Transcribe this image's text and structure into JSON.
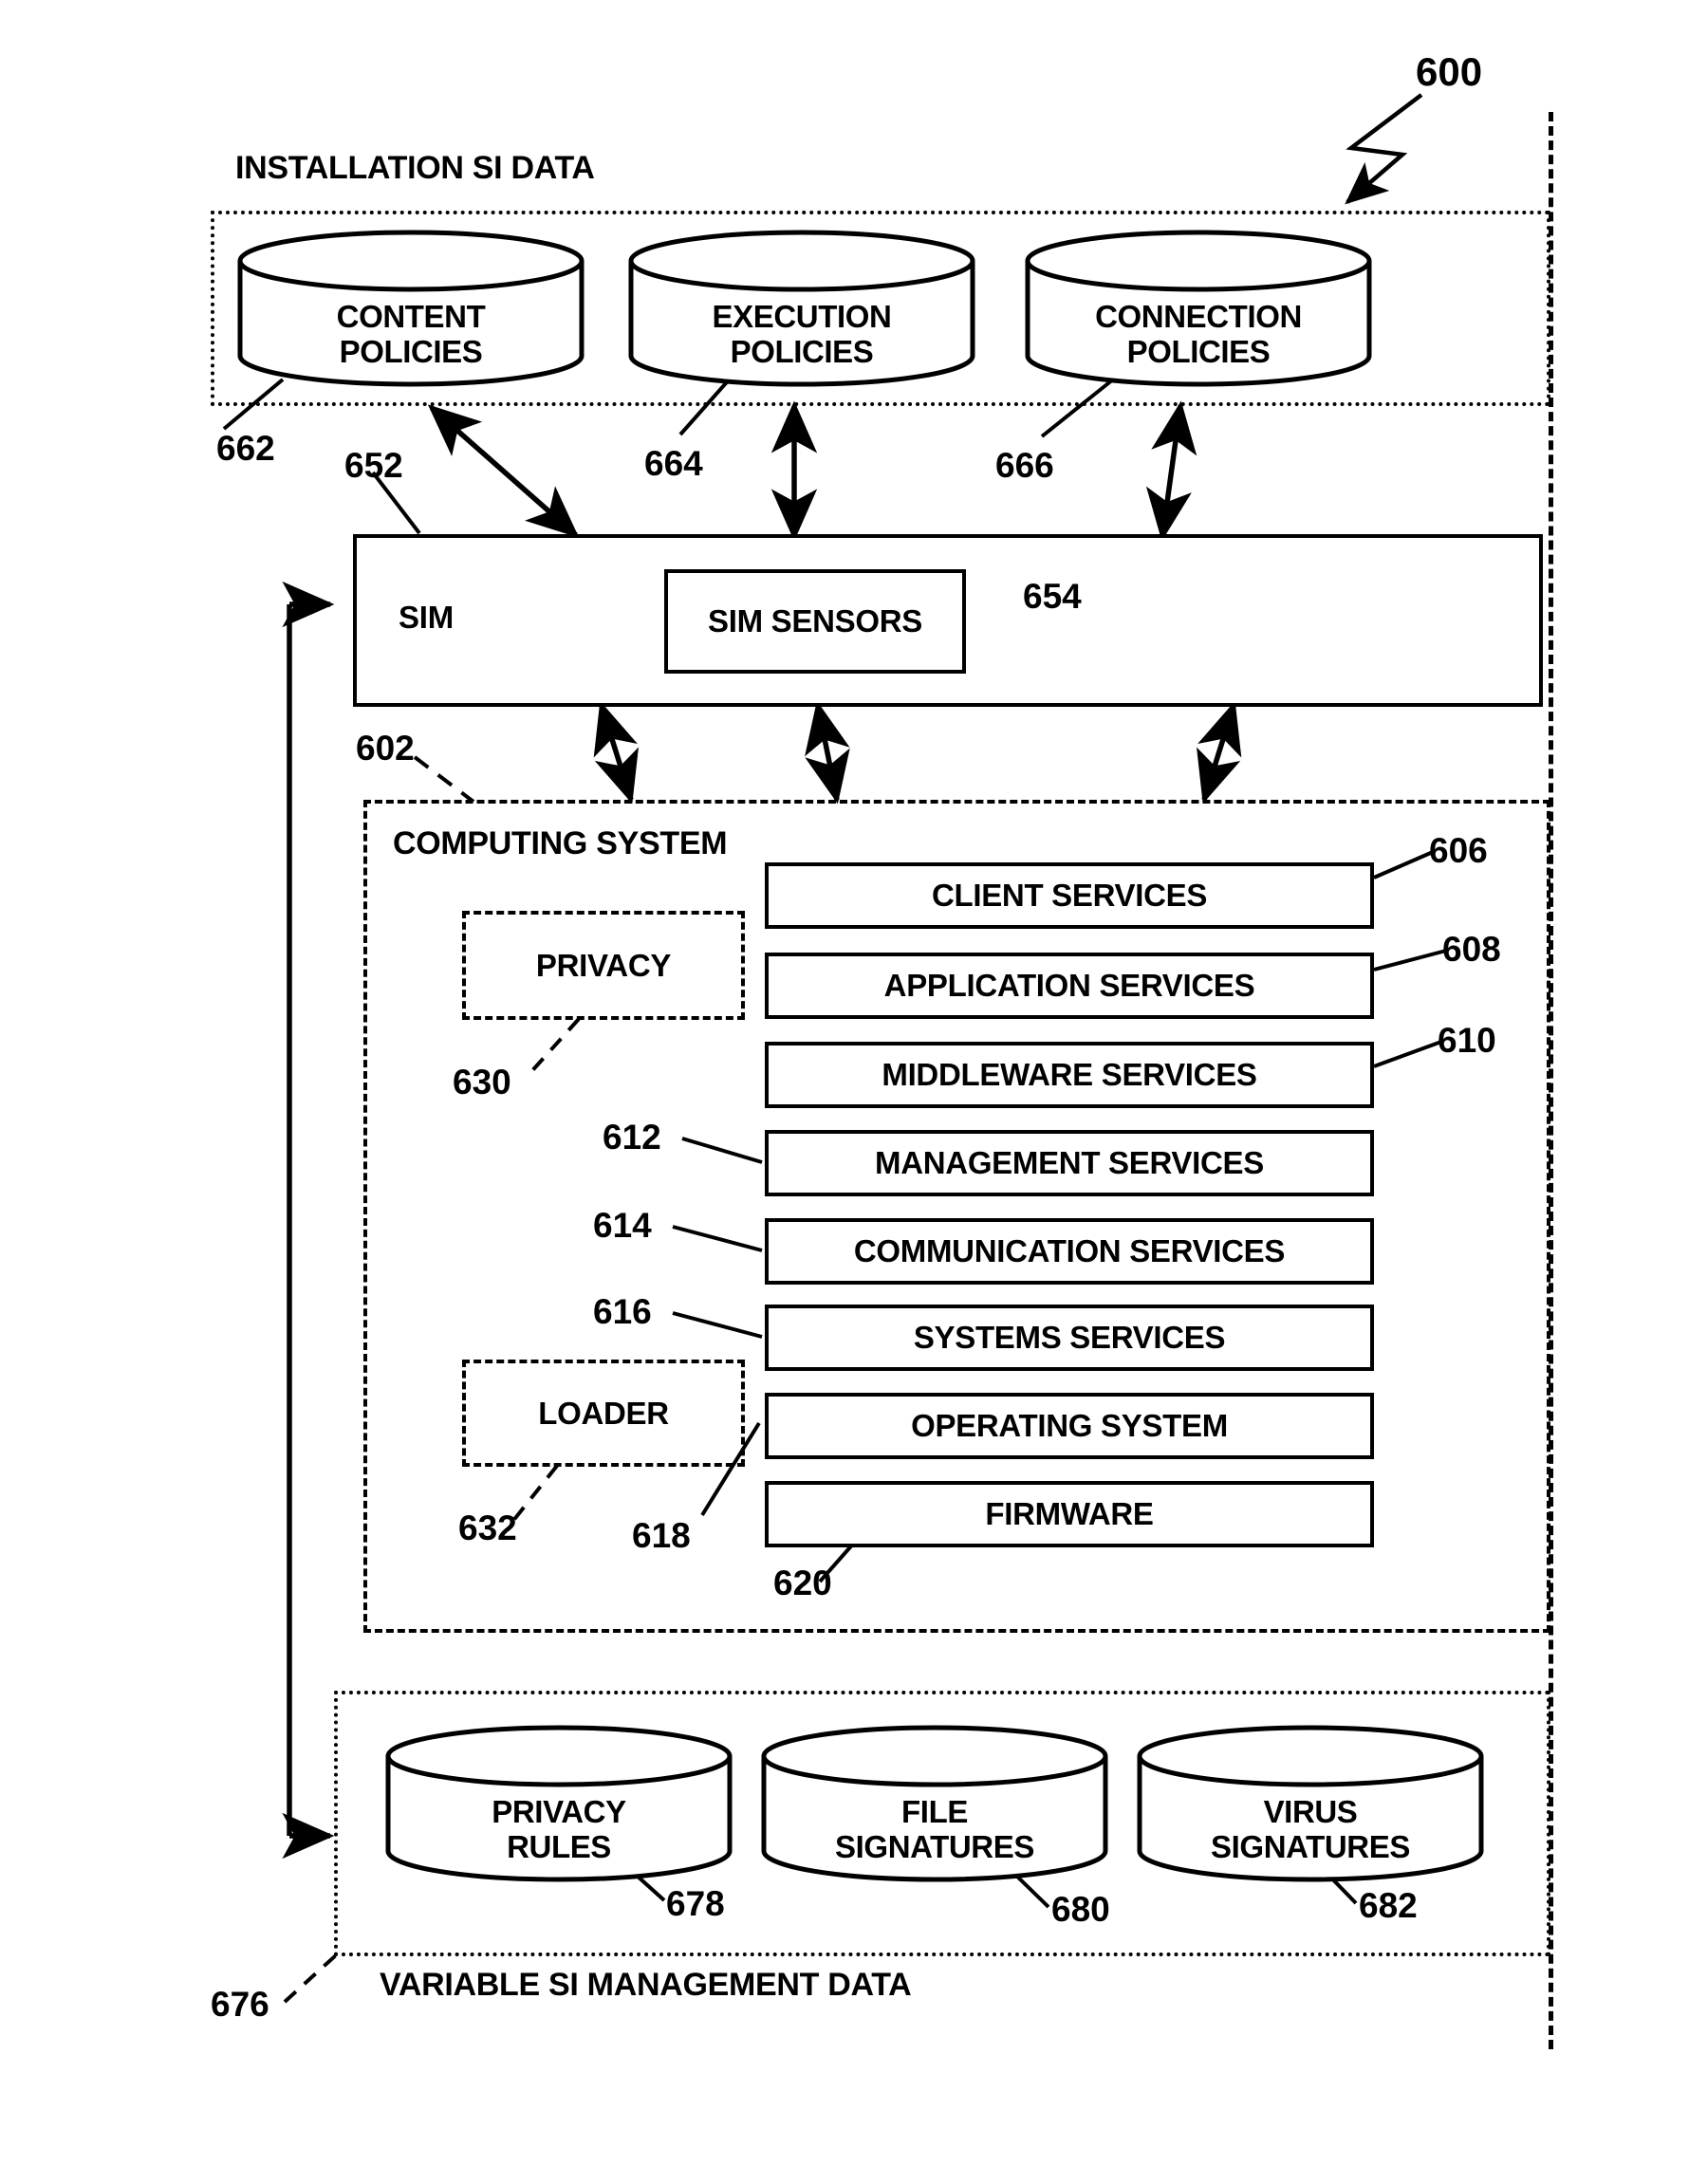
{
  "figure": {
    "number": "600",
    "right_rule_style": "dash-dot"
  },
  "installation": {
    "title": "INSTALLATION SI DATA",
    "ref": "662",
    "stores": [
      {
        "label_line1": "CONTENT",
        "label_line2": "POLICIES",
        "ref": "662"
      },
      {
        "label_line1": "EXECUTION",
        "label_line2": "POLICIES",
        "ref": "664"
      },
      {
        "label_line1": "CONNECTION",
        "label_line2": "POLICIES",
        "ref": "666"
      }
    ]
  },
  "sim": {
    "label": "SIM",
    "ref": "652",
    "sensors": {
      "label": "SIM SENSORS",
      "ref": "654"
    }
  },
  "computing_system": {
    "title": "COMPUTING SYSTEM",
    "ref": "602",
    "modules": [
      {
        "label": "PRIVACY",
        "ref": "630"
      },
      {
        "label": "LOADER",
        "ref": "632"
      }
    ],
    "layers": [
      {
        "label": "CLIENT SERVICES",
        "ref": "606"
      },
      {
        "label": "APPLICATION SERVICES",
        "ref": "608"
      },
      {
        "label": "MIDDLEWARE SERVICES",
        "ref": "610"
      },
      {
        "label": "MANAGEMENT SERVICES",
        "ref": "612"
      },
      {
        "label": "COMMUNICATION SERVICES",
        "ref": "614"
      },
      {
        "label": "SYSTEMS SERVICES",
        "ref": "616"
      },
      {
        "label": "OPERATING SYSTEM",
        "ref": "618"
      },
      {
        "label": "FIRMWARE",
        "ref": "620"
      }
    ]
  },
  "variable_si": {
    "title": "VARIABLE SI MANAGEMENT DATA",
    "ref": "676",
    "stores": [
      {
        "label_line1": "PRIVACY",
        "label_line2": "RULES",
        "ref": "678"
      },
      {
        "label_line1": "FILE",
        "label_line2": "SIGNATURES",
        "ref": "680"
      },
      {
        "label_line1": "VIRUS",
        "label_line2": "SIGNATURES",
        "ref": "682"
      }
    ]
  }
}
